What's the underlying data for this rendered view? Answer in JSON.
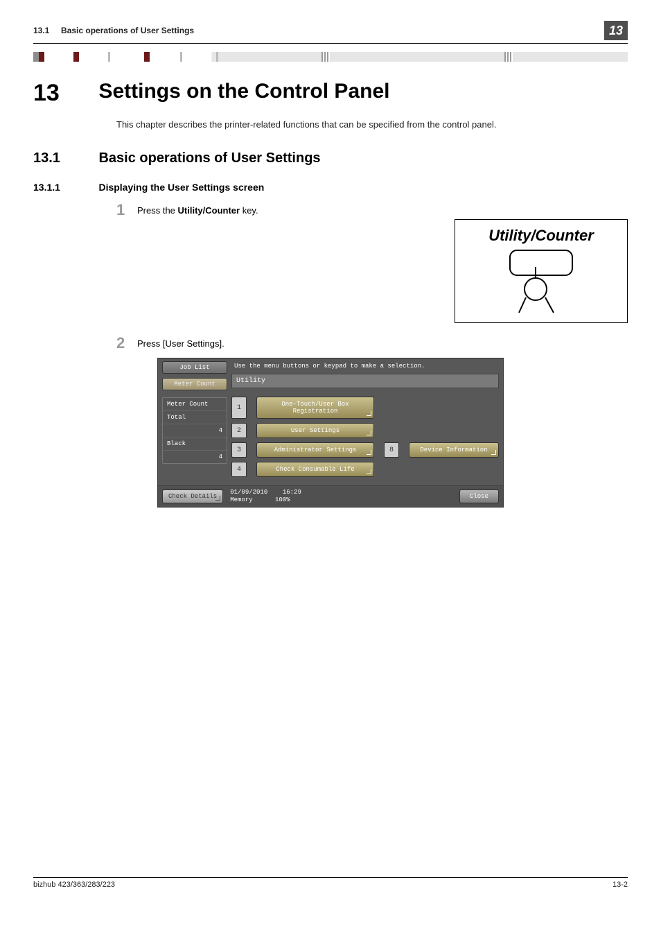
{
  "running_header": {
    "section_num": "13.1",
    "section_title": "Basic operations of User Settings",
    "chapter_box": "13"
  },
  "chapter": {
    "num": "13",
    "title": "Settings on the Control Panel"
  },
  "lead": "This chapter describes the printer-related functions that can be specified from the control panel.",
  "section": {
    "num": "13.1",
    "title": "Basic operations of User Settings"
  },
  "subsection": {
    "num": "13.1.1",
    "title": "Displaying the User Settings screen"
  },
  "steps": {
    "s1": {
      "num": "1",
      "prefix": "Press the ",
      "bold": "Utility/Counter",
      "suffix": " key."
    },
    "s2": {
      "num": "2",
      "text": "Press [User Settings]."
    }
  },
  "figure1_title": "Utility/Counter",
  "panel": {
    "prompt": "Use the menu buttons or keypad to make a selection.",
    "left_tabs": {
      "job_list": "Job List",
      "meter_count": "Meter Count"
    },
    "meter": {
      "header": "Meter Count",
      "total_label": "Total",
      "total_value": "4",
      "black_label": "Black",
      "black_value": "4"
    },
    "check_details": "Check Details",
    "utility_title": "Utility",
    "menu": {
      "m1": {
        "n": "1",
        "label": "One-Touch/User Box\nRegistration"
      },
      "m2": {
        "n": "2",
        "label": "User Settings"
      },
      "m3": {
        "n": "3",
        "label": "Administrator Settings"
      },
      "m4": {
        "n": "4",
        "label": "Check Consumable Life"
      },
      "m8": {
        "n": "8",
        "label": "Device Information"
      }
    },
    "status": {
      "date": "01/09/2010",
      "time": "16:29",
      "mem_label": "Memory",
      "mem_value": "100%"
    },
    "close": "Close"
  },
  "footer": {
    "left": "bizhub 423/363/283/223",
    "right": "13-2"
  }
}
